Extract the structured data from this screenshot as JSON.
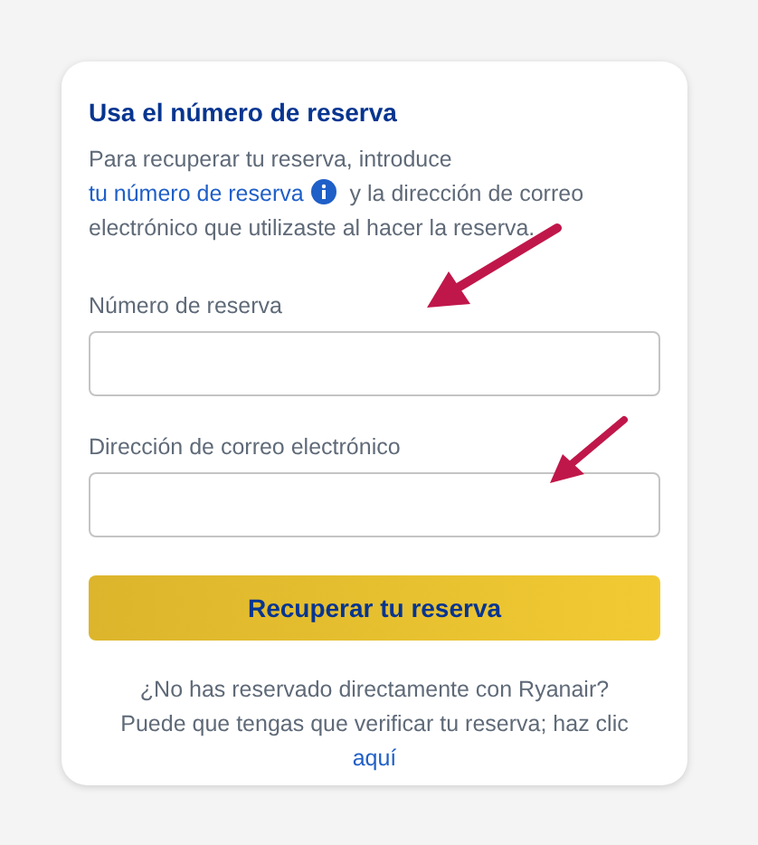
{
  "card": {
    "title": "Usa el número de reserva",
    "intro": {
      "before": "Para recuperar tu reserva, introduce ",
      "link": "tu número de reserva",
      "after": " y la dirección de correo electrónico que utilizaste al hacer la reserva."
    },
    "fields": [
      {
        "label": "Número de reserva"
      },
      {
        "label": "Dirección de correo electrónico"
      }
    ],
    "button": "Recuperar tu reserva",
    "footer": {
      "text": "¿No has reservado directamente con Ryanair? Puede que tengas que verificar tu reserva; haz clic ",
      "link": "aquí"
    }
  }
}
